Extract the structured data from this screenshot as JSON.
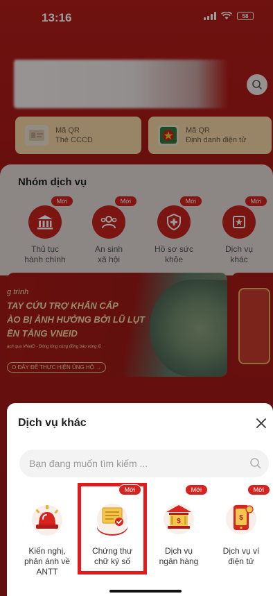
{
  "status": {
    "time": "13:16",
    "battery": "58"
  },
  "qr_cards": [
    {
      "line1": "Mã QR",
      "line2": "Thẻ CCCD"
    },
    {
      "line1": "Mã QR",
      "line2": "Định danh điện tử"
    }
  ],
  "service_group": {
    "title": "Nhóm dịch vụ",
    "items": [
      {
        "label1": "Thủ tục",
        "label2": "hành chính",
        "badge": "Mới",
        "icon": "government-building-icon"
      },
      {
        "label1": "An sinh",
        "label2": "xã hội",
        "badge": "Mới",
        "icon": "social-welfare-icon"
      },
      {
        "label1": "Hồ sơ sức",
        "label2": "khỏe",
        "badge": "Mới",
        "icon": "health-record-icon"
      },
      {
        "label1": "Dịch vụ",
        "label2": "khác",
        "badge": "Mới",
        "icon": "other-services-icon"
      }
    ]
  },
  "banner": {
    "line0": "g trình",
    "line1": "TAY CỨU TRỢ KHẨN CẤP",
    "line2": "ÀO BỊ ẢNH HƯỞNG BỞI LŨ LỤT",
    "line3": "ỀN TẢNG VNEID",
    "line4": "ạch qua VNeID - Đóng lòng cùng đồng bào vùng lũ",
    "cta": "O ĐÂY ĐỂ THỰC HIỆN ỦNG HỘ →"
  },
  "sheet": {
    "title": "Dịch vụ khác",
    "search_placeholder": "Bạn đang muốn tìm kiếm ...",
    "items": [
      {
        "label1": "Kiến nghị,",
        "label2": "phản ánh về",
        "label3": "ANTT",
        "badge": "",
        "icon": "alarm-siren-icon"
      },
      {
        "label1": "Chứng thư",
        "label2": "chữ ký số",
        "label3": "",
        "badge": "Mới",
        "icon": "digital-certificate-icon",
        "selected": true
      },
      {
        "label1": "Dịch vụ",
        "label2": "ngân hàng",
        "label3": "",
        "badge": "Mới",
        "icon": "bank-icon"
      },
      {
        "label1": "Dịch vụ ví",
        "label2": "điện tử",
        "label3": "",
        "badge": "Mới",
        "icon": "e-wallet-icon"
      }
    ]
  },
  "colors": {
    "brand_red": "#d6231f",
    "highlight_red": "#e31a1c",
    "background_red": "#b31d1a"
  }
}
